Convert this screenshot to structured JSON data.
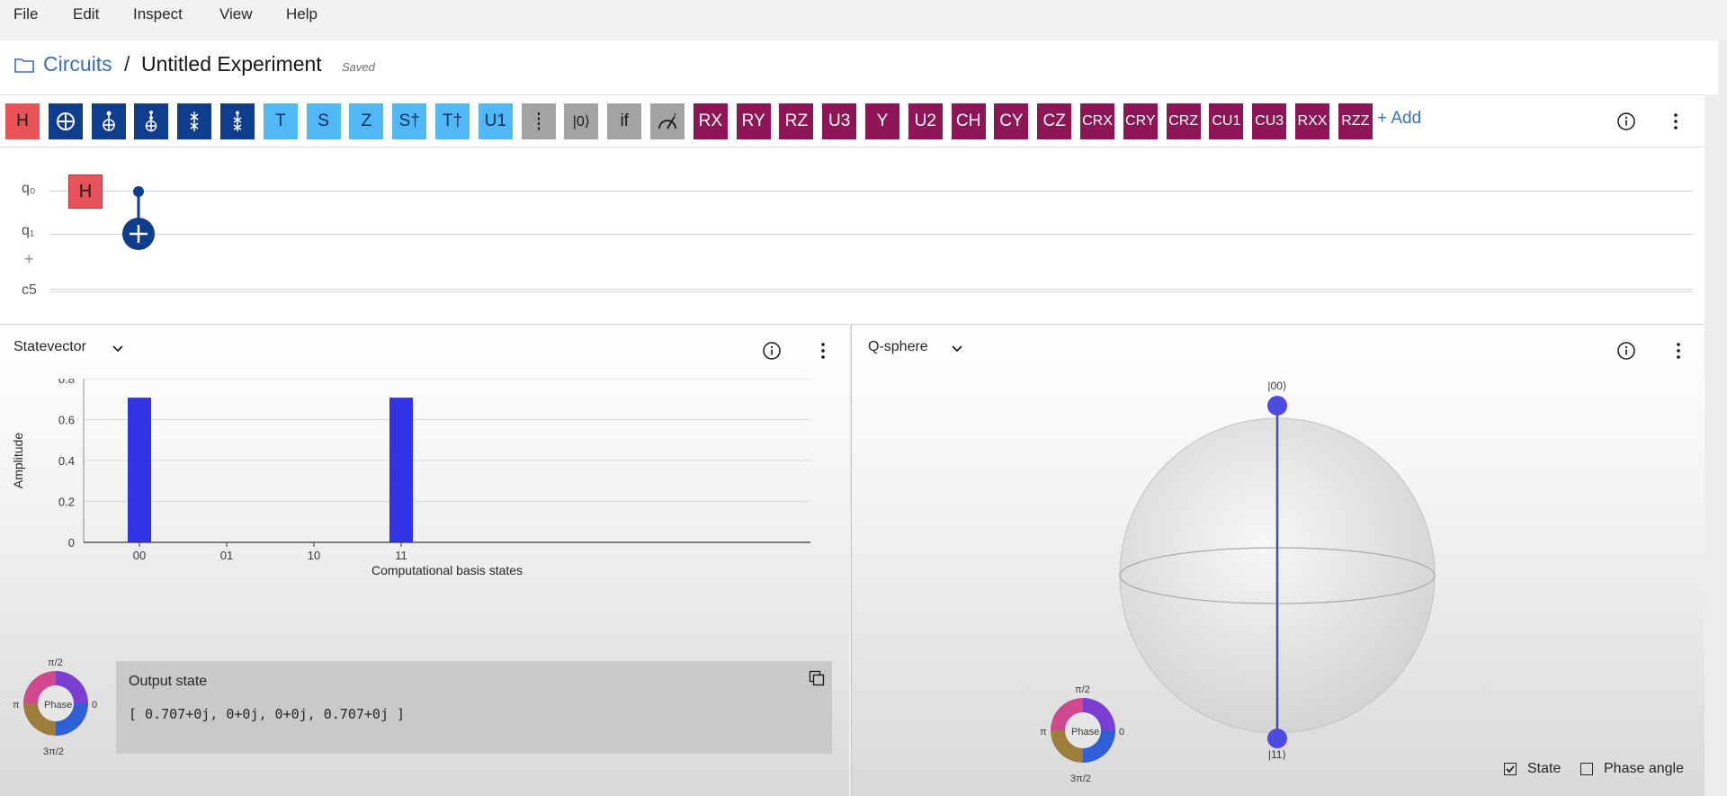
{
  "menu": {
    "items": [
      "File",
      "Edit",
      "Inspect",
      "View",
      "Help"
    ]
  },
  "breadcrumb": {
    "parent": "Circuits",
    "separator": "/",
    "title": "Untitled Experiment",
    "status": "Saved"
  },
  "palette": {
    "gates": [
      {
        "label": "H",
        "style": "red"
      },
      {
        "label": "",
        "icon": "cnot-icon",
        "style": "navy"
      },
      {
        "label": "",
        "icon": "toffoli-icon",
        "style": "navy"
      },
      {
        "label": "",
        "icon": "multi-control-not-icon",
        "style": "navy"
      },
      {
        "label": "",
        "icon": "swap-icon",
        "style": "navy"
      },
      {
        "label": "",
        "icon": "controlled-swap-icon",
        "style": "navy"
      },
      {
        "label": "T",
        "style": "sky"
      },
      {
        "label": "S",
        "style": "sky"
      },
      {
        "label": "Z",
        "style": "sky"
      },
      {
        "label": "S†",
        "style": "sky"
      },
      {
        "label": "T†",
        "style": "sky"
      },
      {
        "label": "U1",
        "style": "sky"
      },
      {
        "label": "",
        "icon": "barrier-icon",
        "style": "gray"
      },
      {
        "label": "|0⟩",
        "style": "gray"
      },
      {
        "label": "if",
        "style": "gray"
      },
      {
        "label": "",
        "icon": "measure-z-icon",
        "style": "gray"
      },
      {
        "label": "RX",
        "style": "wine"
      },
      {
        "label": "RY",
        "style": "wine"
      },
      {
        "label": "RZ",
        "style": "wine"
      },
      {
        "label": "U3",
        "style": "wine"
      },
      {
        "label": "Y",
        "style": "wine"
      },
      {
        "label": "U2",
        "style": "wine"
      },
      {
        "label": "CH",
        "style": "wine"
      },
      {
        "label": "CY",
        "style": "wine"
      },
      {
        "label": "CZ",
        "style": "wine"
      },
      {
        "label": "CRX",
        "style": "wine"
      },
      {
        "label": "CRY",
        "style": "wine"
      },
      {
        "label": "CRZ",
        "style": "wine"
      },
      {
        "label": "CU1",
        "style": "wine"
      },
      {
        "label": "CU3",
        "style": "wine"
      },
      {
        "label": "RXX",
        "style": "wine"
      },
      {
        "label": "RZZ",
        "style": "wine"
      }
    ],
    "add_label": "+ Add"
  },
  "circuit": {
    "qubits": [
      "q₀",
      "q₁"
    ],
    "add_qubit": "+",
    "classical": "c5",
    "h_gate_label": "H"
  },
  "statevector_panel": {
    "title": "Statevector",
    "output_title": "Output state",
    "output_value": "[ 0.707+0j, 0+0j, 0+0j, 0.707+0j ]"
  },
  "qsphere_panel": {
    "title": "Q-sphere",
    "state_top": "|00⟩",
    "state_bottom": "|11⟩",
    "checkbox_state": {
      "label": "State",
      "checked": true
    },
    "checkbox_phase": {
      "label": "Phase angle",
      "checked": false
    }
  },
  "phase_legend": {
    "top": "π/2",
    "left": "π",
    "right": "0",
    "bottom": "3π/2",
    "center": "Phase"
  },
  "colors": {
    "bar": "#3333e6",
    "sphere_node": "#4c4ce0",
    "link": "#3b6fb6"
  },
  "chart_data": {
    "type": "bar",
    "categories": [
      "00",
      "01",
      "10",
      "11"
    ],
    "values": [
      0.707,
      0,
      0,
      0.707
    ],
    "xlabel": "Computational basis states",
    "ylabel": "Amplitude",
    "ylim": [
      0,
      0.8
    ],
    "yticks": [
      "0",
      "0.2",
      "0.4",
      "0.6",
      "0.8"
    ],
    "grid": true
  }
}
